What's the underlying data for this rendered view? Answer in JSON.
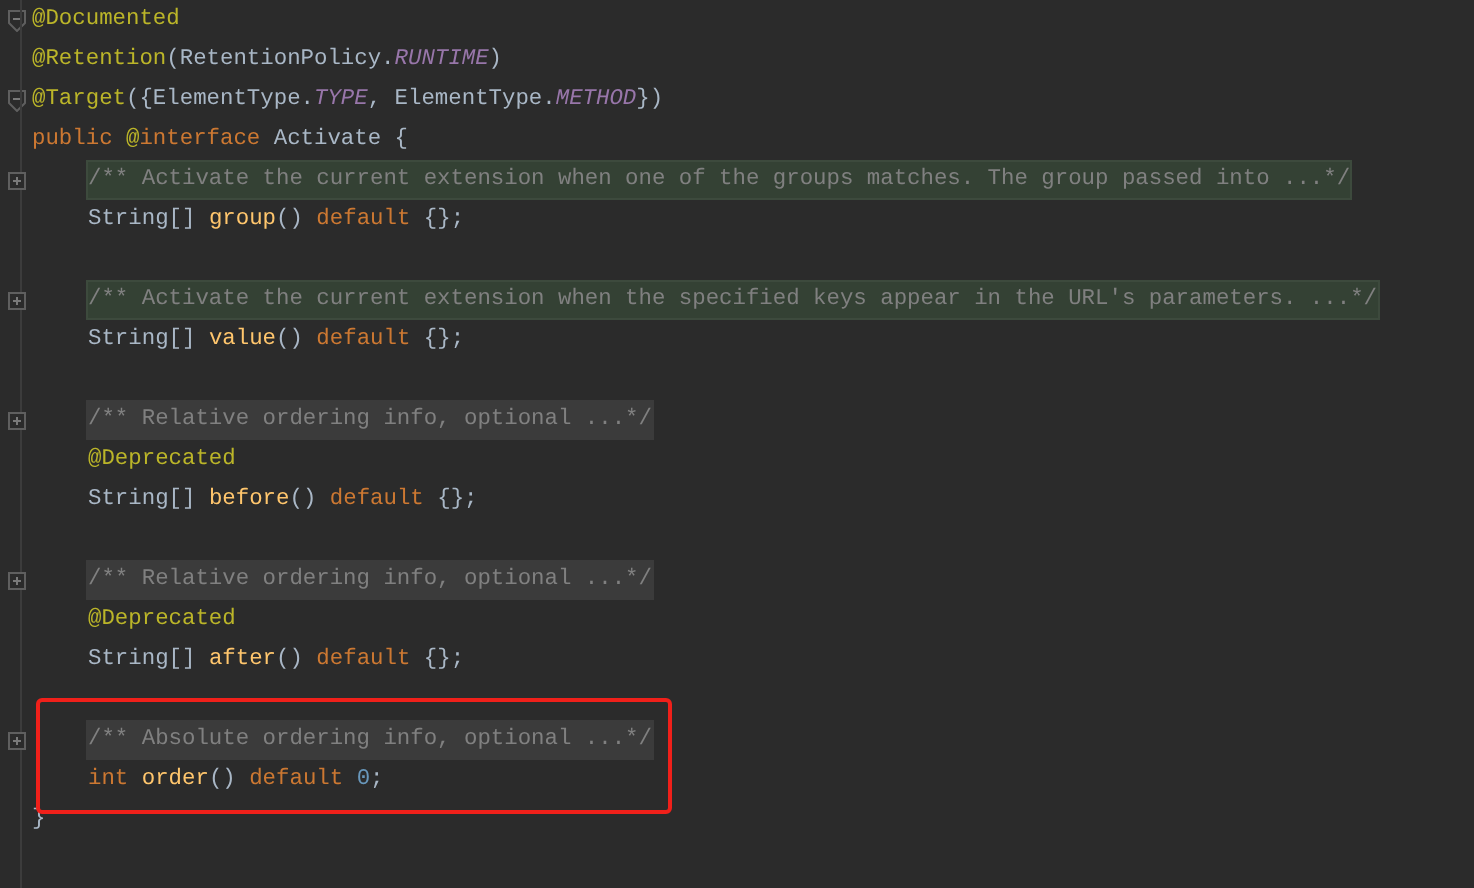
{
  "editor": {
    "lines": [
      {
        "collapsed": false,
        "tokens": [
          {
            "kind": "annotation",
            "text": "@Documented"
          }
        ]
      },
      {
        "tokens": [
          {
            "kind": "annotation",
            "text": "@Retention"
          },
          {
            "kind": "plain",
            "text": "(RetentionPolicy."
          },
          {
            "kind": "constant",
            "text": "RUNTIME"
          },
          {
            "kind": "plain",
            "text": ")"
          }
        ]
      },
      {
        "collapsed": false,
        "tokens": [
          {
            "kind": "annotation",
            "text": "@Target"
          },
          {
            "kind": "plain",
            "text": "({ElementType."
          },
          {
            "kind": "constant",
            "text": "TYPE"
          },
          {
            "kind": "plain",
            "text": ", ElementType."
          },
          {
            "kind": "constant",
            "text": "METHOD"
          },
          {
            "kind": "plain",
            "text": "})"
          }
        ]
      },
      {
        "tokens": [
          {
            "kind": "keyword",
            "text": "public "
          },
          {
            "kind": "annotation",
            "text": "@"
          },
          {
            "kind": "keyword",
            "text": "interface "
          },
          {
            "kind": "plain",
            "text": "Activate {"
          }
        ],
        "members": [
          {
            "outlined": false,
            "lines": [
              {
                "collapsed": true,
                "comment": {
                  "text": "/** Activate the current extension when one of the groups matches. The group passed into ...*/",
                  "highlighted": true
                }
              },
              {
                "tokens": [
                  {
                    "kind": "plain",
                    "text": "String[] "
                  },
                  {
                    "kind": "method",
                    "text": "group"
                  },
                  {
                    "kind": "plain",
                    "text": "() "
                  },
                  {
                    "kind": "keyword",
                    "text": "default "
                  },
                  {
                    "kind": "plain",
                    "text": "{};"
                  }
                ]
              }
            ]
          },
          {
            "outlined": false,
            "lines": [
              {
                "collapsed": true,
                "comment": {
                  "text": "/** Activate the current extension when the specified keys appear in the URL's parameters. ...*/",
                  "highlighted": true
                }
              },
              {
                "tokens": [
                  {
                    "kind": "plain",
                    "text": "String[] "
                  },
                  {
                    "kind": "method",
                    "text": "value"
                  },
                  {
                    "kind": "plain",
                    "text": "() "
                  },
                  {
                    "kind": "keyword",
                    "text": "default "
                  },
                  {
                    "kind": "plain",
                    "text": "{};"
                  }
                ]
              }
            ]
          },
          {
            "outlined": false,
            "lines": [
              {
                "collapsed": true,
                "comment": {
                  "text": "/** Relative ordering info, optional ...*/",
                  "highlighted": false
                }
              },
              {
                "tokens": [
                  {
                    "kind": "annotation",
                    "text": "@Deprecated"
                  }
                ]
              },
              {
                "tokens": [
                  {
                    "kind": "plain",
                    "text": "String[] "
                  },
                  {
                    "kind": "method",
                    "text": "before"
                  },
                  {
                    "kind": "plain",
                    "text": "() "
                  },
                  {
                    "kind": "keyword",
                    "text": "default "
                  },
                  {
                    "kind": "plain",
                    "text": "{};"
                  }
                ]
              }
            ]
          },
          {
            "outlined": false,
            "lines": [
              {
                "collapsed": true,
                "comment": {
                  "text": "/** Relative ordering info, optional ...*/",
                  "highlighted": false
                }
              },
              {
                "tokens": [
                  {
                    "kind": "annotation",
                    "text": "@Deprecated"
                  }
                ]
              },
              {
                "tokens": [
                  {
                    "kind": "plain",
                    "text": "String[] "
                  },
                  {
                    "kind": "method",
                    "text": "after"
                  },
                  {
                    "kind": "plain",
                    "text": "() "
                  },
                  {
                    "kind": "keyword",
                    "text": "default "
                  },
                  {
                    "kind": "plain",
                    "text": "{};"
                  }
                ]
              }
            ]
          },
          {
            "outlined": true,
            "lines": [
              {
                "collapsed": true,
                "comment": {
                  "text": "/** Absolute ordering info, optional ...*/",
                  "highlighted": false
                }
              },
              {
                "tokens": [
                  {
                    "kind": "keyword",
                    "text": "int "
                  },
                  {
                    "kind": "method",
                    "text": "order"
                  },
                  {
                    "kind": "plain",
                    "text": "() "
                  },
                  {
                    "kind": "keyword",
                    "text": "default "
                  },
                  {
                    "kind": "number",
                    "text": "0"
                  },
                  {
                    "kind": "plain",
                    "text": ";"
                  }
                ]
              }
            ]
          }
        ]
      },
      {
        "tokens": [
          {
            "kind": "plain",
            "text": "}"
          }
        ]
      }
    ]
  }
}
